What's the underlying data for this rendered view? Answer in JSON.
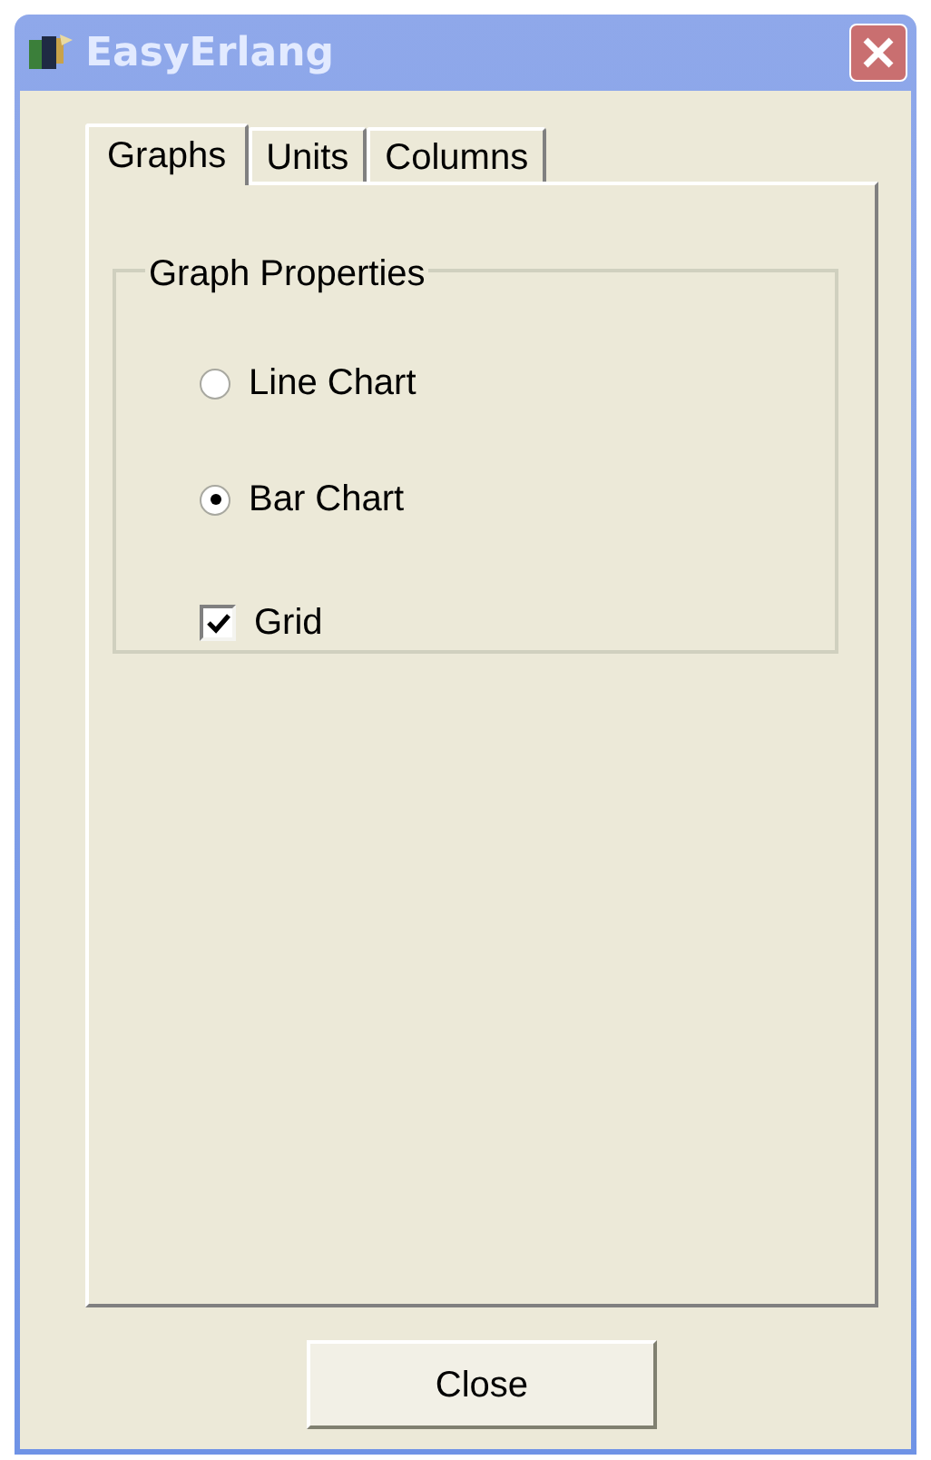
{
  "window": {
    "title": "EasyErlang"
  },
  "tabs": [
    {
      "label": "Graphs",
      "selected": true
    },
    {
      "label": "Units",
      "selected": false
    },
    {
      "label": "Columns",
      "selected": false
    }
  ],
  "group": {
    "title": "Graph Properties",
    "options": [
      {
        "kind": "radio",
        "label": "Line Chart",
        "selected": false
      },
      {
        "kind": "radio",
        "label": "Bar Chart",
        "selected": true
      },
      {
        "kind": "checkbox",
        "label": "Grid",
        "checked": true
      }
    ]
  },
  "buttons": [
    "Close"
  ]
}
